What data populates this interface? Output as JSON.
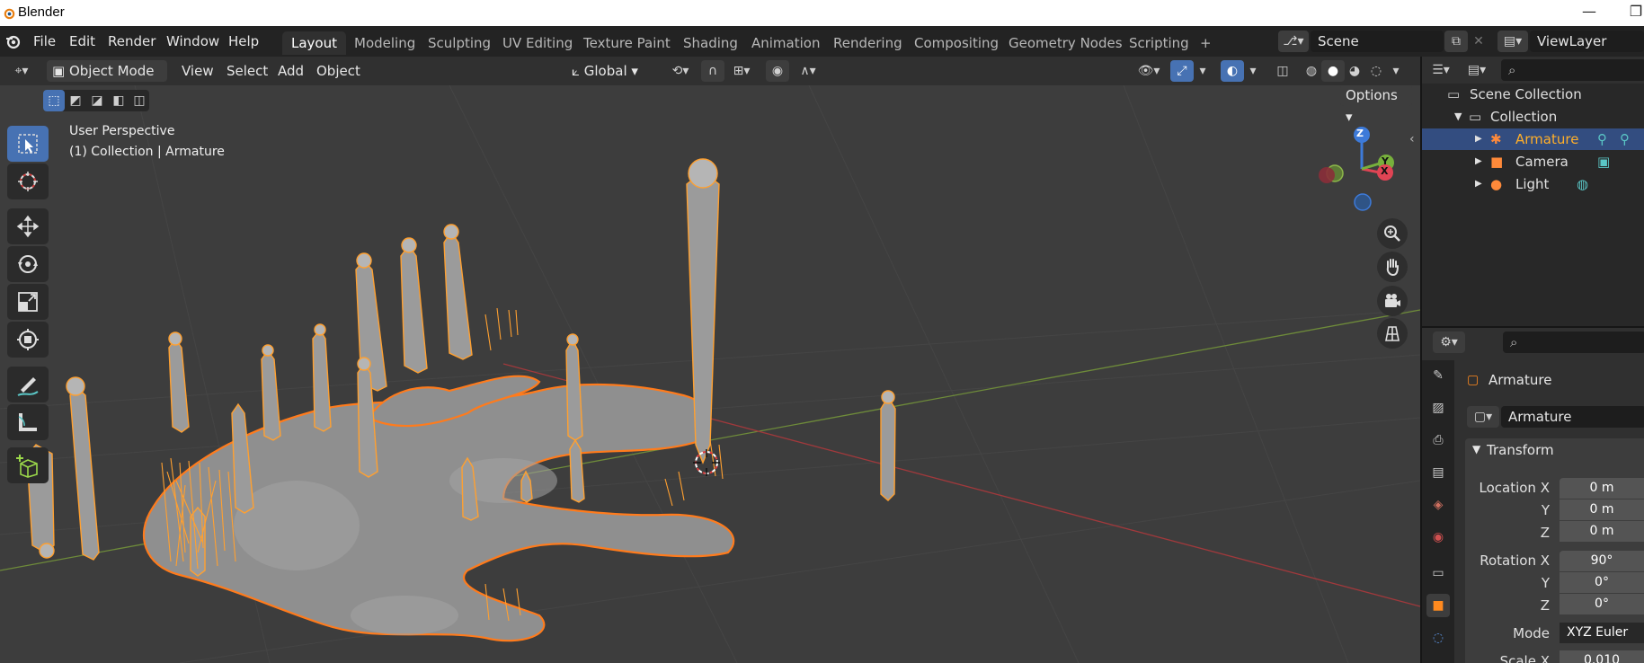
{
  "window": {
    "title": "Blender",
    "minimize": "—",
    "restore": "❐"
  },
  "menu": [
    "File",
    "Edit",
    "Render",
    "Window",
    "Help"
  ],
  "workspaces": [
    "Layout",
    "Modeling",
    "Sculpting",
    "UV Editing",
    "Texture Paint",
    "Shading",
    "Animation",
    "Rendering",
    "Compositing",
    "Geometry Nodes",
    "Scripting"
  ],
  "workspace_add": "+",
  "scene": {
    "name": "Scene"
  },
  "view_layer": {
    "name": "ViewLayer"
  },
  "viewport_header": {
    "mode": "Object Mode",
    "menus": [
      "View",
      "Select",
      "Add",
      "Object"
    ],
    "transform_orientation": "Global",
    "options": "Options"
  },
  "viewport": {
    "perspective_label": "User Perspective",
    "context_label": "(1) Collection | Armature",
    "gizmo_axes": {
      "z": "Z",
      "y": "Y",
      "x": "X"
    }
  },
  "outliner": {
    "root": "Scene Collection",
    "collection": "Collection",
    "items": [
      {
        "label": "Armature",
        "selected": true
      },
      {
        "label": "Camera",
        "selected": false
      },
      {
        "label": "Light",
        "selected": false
      }
    ]
  },
  "properties": {
    "object_name": "Armature",
    "data_name": "Armature",
    "panel": "Transform",
    "location": {
      "label_x": "Location X",
      "label_y": "Y",
      "label_z": "Z",
      "x": "0 m",
      "y": "0 m",
      "z": "0 m"
    },
    "rotation": {
      "label_x": "Rotation X",
      "label_y": "Y",
      "label_z": "Z",
      "x": "90°",
      "y": "0°",
      "z": "0°"
    },
    "mode": {
      "label": "Mode",
      "value": "XYZ Euler"
    },
    "scale": {
      "label_x": "Scale X",
      "x": "0.010"
    }
  },
  "colors": {
    "accent": "#4772b3",
    "selection": "#ff8a1f",
    "header": "#232323",
    "viewport_bg": "#3d3d3d"
  }
}
